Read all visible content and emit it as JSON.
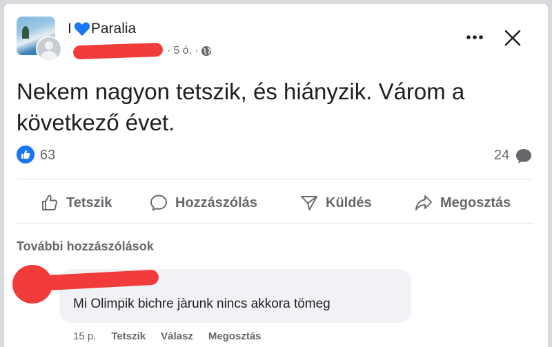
{
  "post": {
    "group": {
      "prefix": "I",
      "name": "Paralia"
    },
    "time": "5 ó.",
    "separator": "·",
    "text": "Nekem nagyon tetszik, és hiányzik. Várom a következő évet.",
    "likes": "63",
    "comments": "24"
  },
  "actions": {
    "like": "Tetszik",
    "comment": "Hozzászólás",
    "send": "Küldés",
    "share": "Megosztás"
  },
  "comments_section": {
    "more_label": "További hozzászólások",
    "items": [
      {
        "text": "Mi Olimpik bichre jàrunk nincs akkora tömeg",
        "time": "15 p.",
        "like": "Tetszik",
        "reply": "Válasz",
        "share": "Megosztás"
      }
    ]
  },
  "colors": {
    "accent": "#1877f2",
    "redaction": "#f23b3b",
    "muted": "#65676b"
  },
  "icons": [
    "heart-icon",
    "globe-icon",
    "more-icon",
    "close-icon",
    "like-icon",
    "comment-icon",
    "send-icon",
    "share-icon"
  ]
}
